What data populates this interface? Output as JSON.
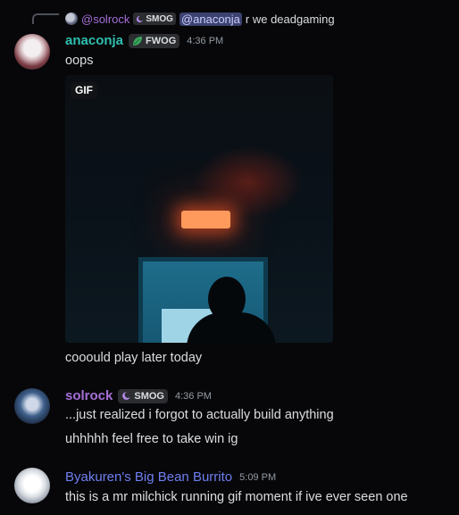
{
  "reply": {
    "username": "@solrock",
    "tag": "SMOG",
    "mention": "@anaconja",
    "text": "r we deadgaming"
  },
  "messages": [
    {
      "username": "anaconja",
      "name_color": "#2fbfb0",
      "tag": "FWOG",
      "tag_icon": "leaf-icon",
      "timestamp": "4:36 PM",
      "lines": [
        "oops"
      ],
      "gif_label": "GIF",
      "after_gif": "cooould play later today"
    },
    {
      "username": "solrock",
      "name_color": "#a46fd8",
      "tag": "SMOG",
      "tag_icon": "moon-icon",
      "timestamp": "4:36 PM",
      "lines": [
        "...just realized i forgot to actually build anything",
        "uhhhhh feel free to take win ig"
      ]
    },
    {
      "username": "Byakuren's Big Bean Burrito",
      "name_color": "#6e7ff0",
      "timestamp": "5:09 PM",
      "lines": [
        "this is a mr milchick running gif moment if ive ever seen one"
      ]
    }
  ]
}
